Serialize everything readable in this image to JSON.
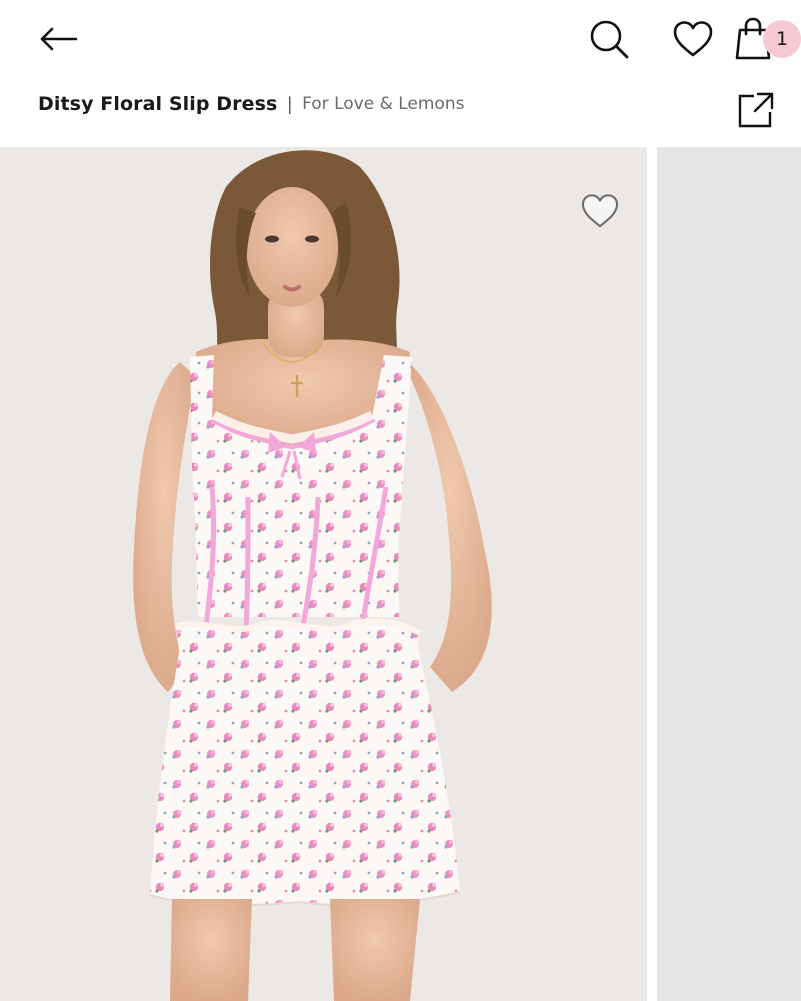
{
  "header": {
    "back_icon": "arrow-left-icon",
    "search_icon": "search-icon",
    "wishlist_icon": "heart-icon",
    "bag_icon": "shopping-bag-icon",
    "bag_count": "1",
    "badge_color": "#f7c9d3"
  },
  "product": {
    "name": "Ditsy Floral Slip Dress",
    "separator": "|",
    "brand": "For Love & Lemons",
    "share_icon": "share-icon"
  },
  "gallery": {
    "favorite_icon": "heart-outline-icon",
    "image_description": "Model wearing white corset-style mini dress with pink floral print and pink ribbon trim",
    "bg_color": "#edeae8",
    "dress_accent": "#f2a8d8"
  }
}
